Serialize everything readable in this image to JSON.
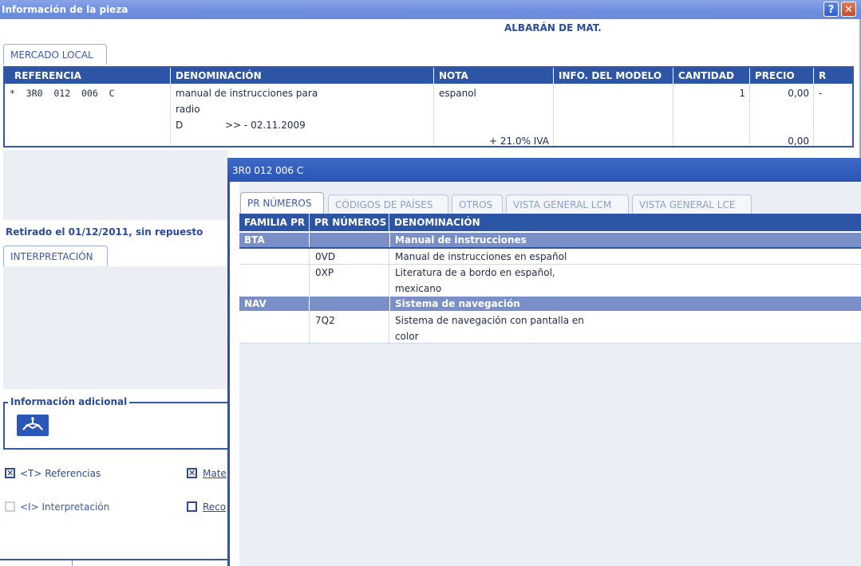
{
  "window": {
    "title": "Información de la pieza",
    "help_glyph": "?",
    "close_glyph": "✕"
  },
  "main": {
    "header_right": "ALBARÁN DE MAT.",
    "tab_local": "MERCADO LOCAL",
    "table": {
      "columns": [
        "REFERENCIA",
        "DENOMINACIÓN",
        "NOTA",
        "INFO. DEL MODELO",
        "CANTIDAD",
        "PRECIO",
        "R"
      ],
      "row": {
        "referencia": "*  3R0  012  006  C",
        "denom_line1": "manual de instrucciones para",
        "denom_line2": "radio",
        "denom_line3_a": "D",
        "denom_line3_b": ">> - 02.11.2009",
        "nota": "espanol",
        "cantidad": "1",
        "precio": "0,00",
        "r": "-",
        "iva_label": "+ 21.0% IVA",
        "iva_precio": "0,00"
      }
    },
    "retired_text": "Retirado el 01/12/2011, sin repuesto",
    "tab_interpretacion": "INTERPRETACIÓN",
    "info_adicional_label": "Información adicional",
    "logo_icon": "crown-logo-icon",
    "checkboxes": [
      {
        "label": "<T> Referencias",
        "checked": true
      },
      {
        "label": "Mate",
        "checked": true
      },
      {
        "label": "<I> Interpretación",
        "checked": false
      },
      {
        "label": "Reco",
        "checked": false
      }
    ]
  },
  "popup": {
    "title": "3R0 012 006 C",
    "tabs": [
      "PR NÚMEROS",
      "CÓDIGOS DE PAÍSES",
      "OTROS",
      "VISTA GENERAL LCM",
      "VISTA GENERAL LCE"
    ],
    "columns": [
      "FAMILIA PR",
      "PR NÚMEROS",
      "DENOMINACIÓN"
    ],
    "groups": [
      {
        "familia": "BTA",
        "denominacion": "Manual de instrucciones",
        "items": [
          {
            "pr": "0VD",
            "lines": [
              "Manual de instrucciones en español"
            ]
          },
          {
            "pr": "0XP",
            "lines": [
              "Literatura de a bordo en español,",
              "mexicano"
            ]
          }
        ]
      },
      {
        "familia": "NAV",
        "denominacion": "Sistema de navegación",
        "items": [
          {
            "pr": "7Q2",
            "lines": [
              "Sistema de navegación con pantalla en",
              "color"
            ]
          }
        ]
      }
    ]
  },
  "colors": {
    "header_blue": "#2c55a6",
    "group_blue": "#7a8fc8",
    "title_blue": "#6f8fe0"
  }
}
